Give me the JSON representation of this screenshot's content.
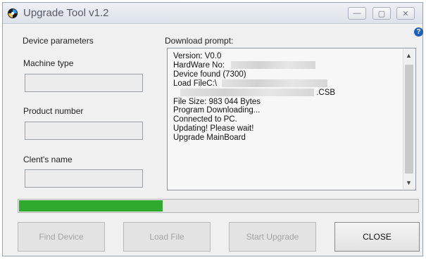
{
  "window": {
    "title": "Upgrade Tool v1.2",
    "icons": [
      "app-icon",
      "minimize-icon",
      "maximize-icon",
      "close-icon",
      "help-icon"
    ]
  },
  "left_panel": {
    "section_title": "Device parameters",
    "machine_type_label": "Machine type",
    "machine_type_value": "",
    "product_number_label": "Product number",
    "product_number_value": "",
    "client_name_label": "Clent's name",
    "client_name_value": ""
  },
  "download": {
    "label": "Download prompt:",
    "lines": {
      "version": "Version:  V0.0",
      "hardware": "HardWare No:",
      "device_found": "Device found  (7300)",
      "load_file": "Load FileC:\\",
      "file_ext": ".CSB",
      "file_size": "File Size: 983 044 Bytes",
      "program": "Program Downloading...",
      "connected": "Connected to PC.",
      "updating": "Updating! Please wait!",
      "upgrade": "Upgrade MainBoard"
    }
  },
  "progress": {
    "fraction": 0.36,
    "color": "#2faa2f"
  },
  "buttons": {
    "find_device": "Find Device",
    "load_file": "Load File",
    "start_upgrade": "Start Upgrade",
    "close": "CLOSE"
  }
}
